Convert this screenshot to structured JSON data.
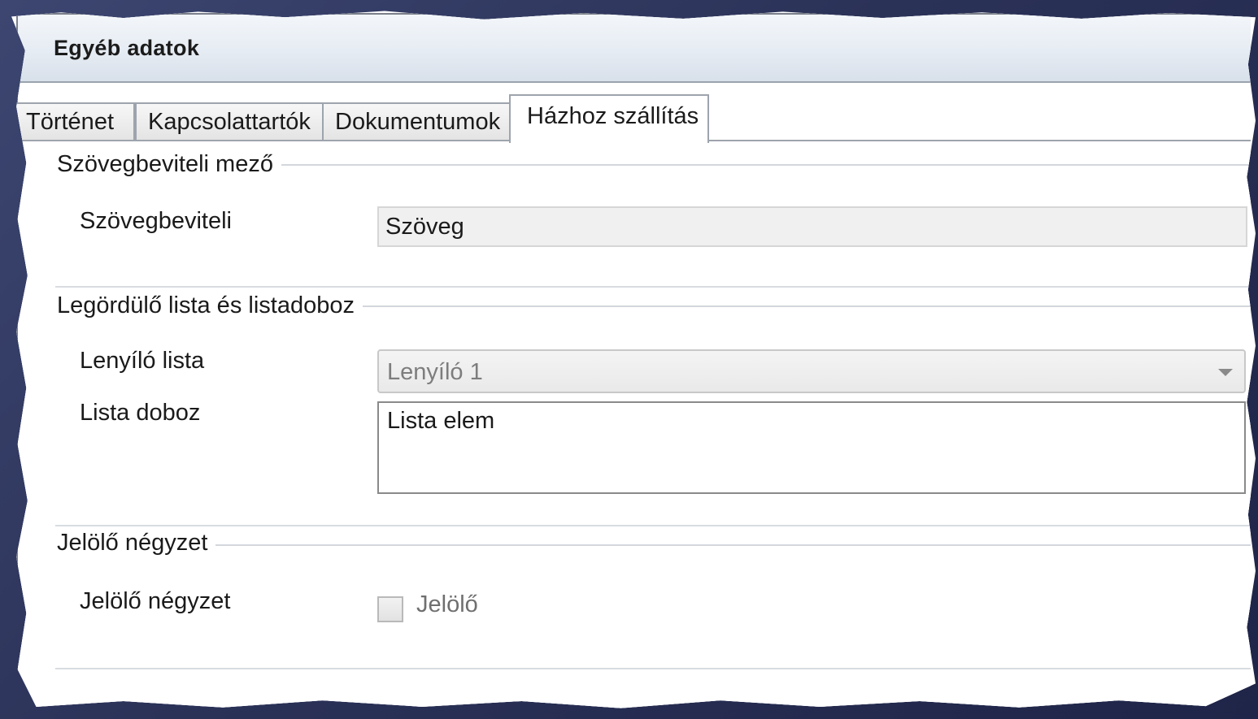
{
  "window": {
    "title": "Egyéb adatok"
  },
  "tabs": [
    {
      "label": "Történet"
    },
    {
      "label": "Kapcsolattartók"
    },
    {
      "label": "Dokumentumok"
    },
    {
      "label": "Házhoz szállítás",
      "active": true
    }
  ],
  "groups": {
    "text_input": {
      "title": "Szövegbeviteli mező",
      "field_label": "Szövegbeviteli",
      "field_value": "Szöveg"
    },
    "dropdown_list": {
      "title": "Legördülő lista és listadoboz",
      "dropdown_label": "Lenyíló lista",
      "dropdown_selected": "Lenyíló 1",
      "listbox_label": "Lista doboz",
      "listbox_items": [
        "Lista elem"
      ]
    },
    "checkbox": {
      "title": "Jelölő négyzet",
      "field_label": "Jelölő négyzet",
      "checkbox_label": "Jelölő",
      "checked": false
    }
  },
  "colors": {
    "background": "#2b3258",
    "title_bar": "#e6ecf3",
    "disabled_text": "#7d7d7d"
  }
}
